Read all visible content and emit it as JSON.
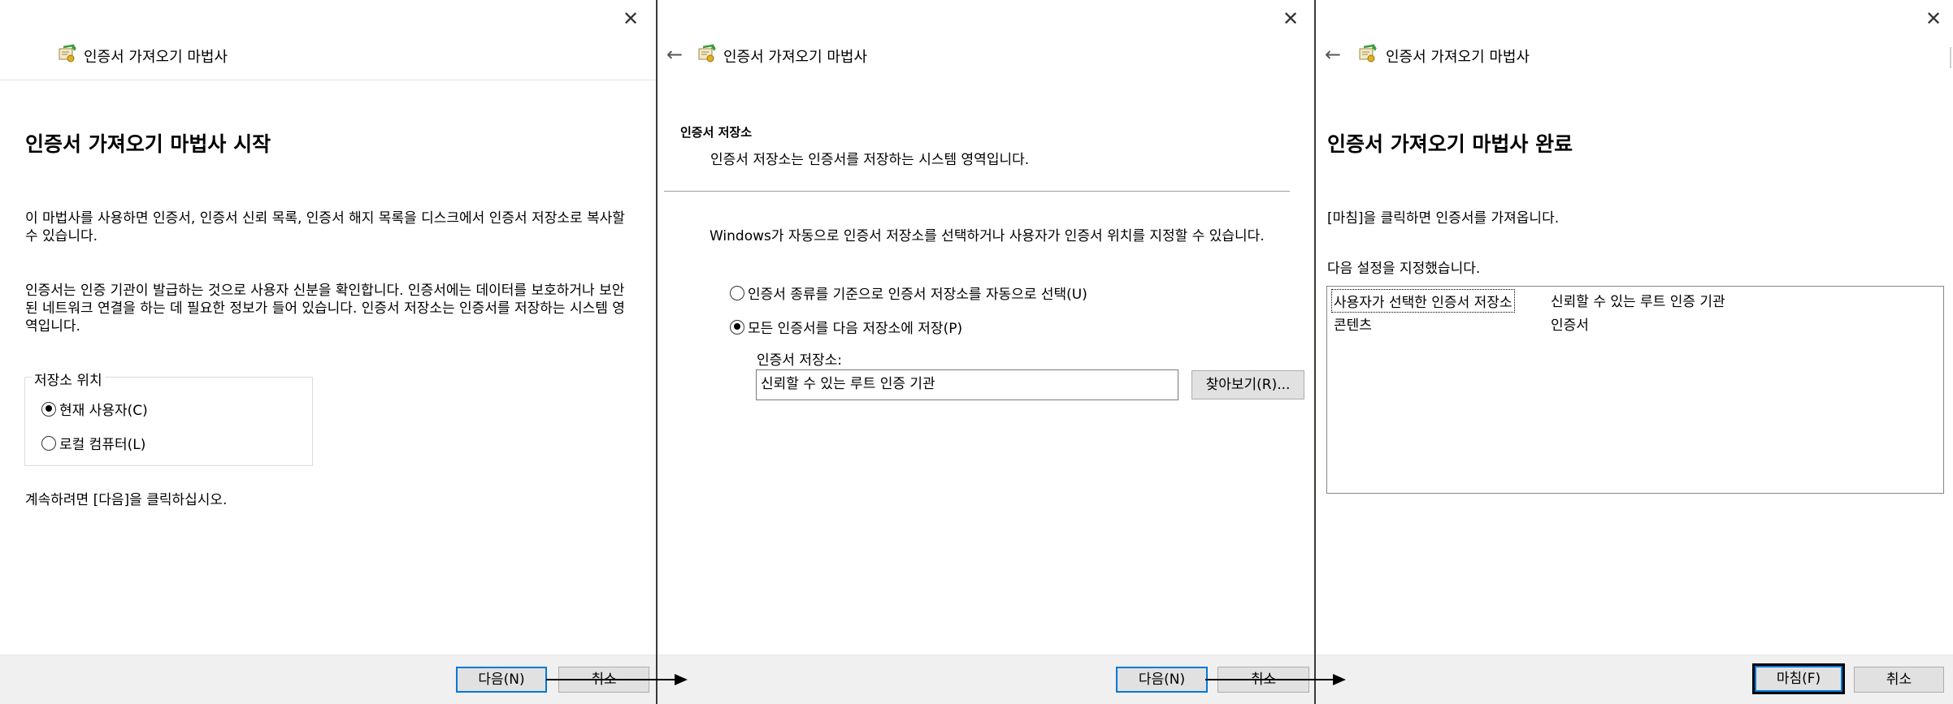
{
  "wizard": {
    "title": "인증서 가져오기 마법사",
    "close_glyph": "✕",
    "back_glyph": "←"
  },
  "panel1": {
    "heading": "인증서 가져오기 마법사 시작",
    "para1": "이 마법사를 사용하면 인증서, 인증서 신뢰 목록, 인증서 해지 목록을 디스크에서 인증서 저장소로 복사할 수 있습니다.",
    "para2": "인증서는 인증 기관이 발급하는 것으로 사용자 신분을 확인합니다. 인증서에는 데이터를 보호하거나 보안된 네트워크 연결을 하는 데 필요한 정보가 들어 있습니다. 인증서 저장소는 인증서를 저장하는 시스템 영역입니다.",
    "group_label": "저장소 위치",
    "radio_current_user": "현재 사용자(C)",
    "radio_local_machine": "로컬 컴퓨터(L)",
    "selected": "current_user",
    "continue_text": "계속하려면 [다음]을 클릭하십시오.",
    "next_button": "다음(N)",
    "cancel_button": "취소"
  },
  "panel2": {
    "section_title": "인증서 저장소",
    "section_desc": "인증서 저장소는 인증서를 저장하는 시스템 영역입니다.",
    "para": "Windows가 자동으로 인증서 저장소를 선택하거나 사용자가 인증서 위치를 지정할 수 있습니다.",
    "radio_auto": "인증서 종류를 기준으로 인증서 저장소를 자동으로 선택(U)",
    "radio_manual": "모든 인증서를 다음 저장소에 저장(P)",
    "selected": "manual",
    "store_label": "인증서 저장소:",
    "store_value": "신뢰할 수 있는 루트 인증 기관",
    "browse_button": "찾아보기(R)...",
    "next_button": "다음(N)",
    "cancel_button": "취소"
  },
  "panel3": {
    "heading": "인증서 가져오기 마법사 완료",
    "para1": "[마침]을 클릭하면 인증서를 가져옵니다.",
    "para2": "다음 설정을 지정했습니다.",
    "settings": [
      {
        "key": "사용자가 선택한 인증서 저장소",
        "value": "신뢰할 수 있는 루트 인증 기관"
      },
      {
        "key": "콘텐츠",
        "value": "인증서"
      }
    ],
    "finish_button": "마침(F)",
    "cancel_button": "취소"
  },
  "colors": {
    "accent_blue": "#0078d7",
    "footer_bg": "#f0f0f0",
    "button_bg": "#e1e1e1"
  }
}
